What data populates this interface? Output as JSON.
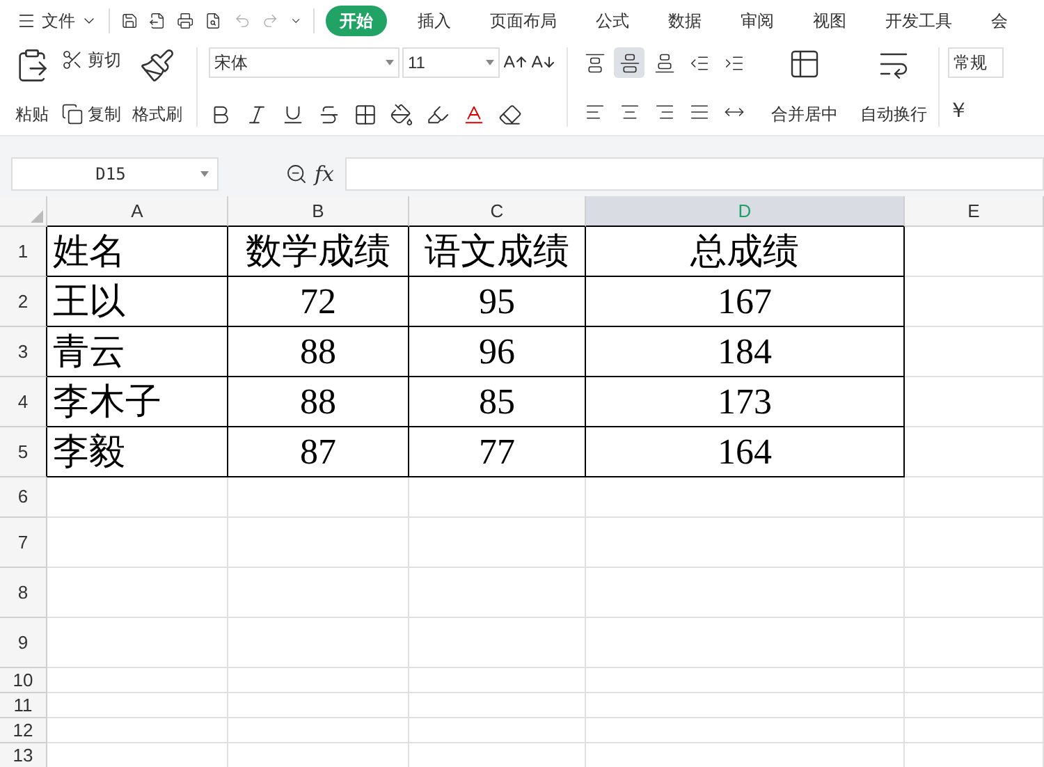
{
  "menu": {
    "label": "文件"
  },
  "tabs": [
    {
      "label": "开始",
      "selected": true
    },
    {
      "label": "插入",
      "selected": false
    },
    {
      "label": "页面布局",
      "selected": false
    },
    {
      "label": "公式",
      "selected": false
    },
    {
      "label": "数据",
      "selected": false
    },
    {
      "label": "审阅",
      "selected": false
    },
    {
      "label": "视图",
      "selected": false
    },
    {
      "label": "开发工具",
      "selected": false
    },
    {
      "label": "会",
      "selected": false
    }
  ],
  "clipboard": {
    "paste": "粘贴",
    "cut": "剪切",
    "copy": "复制",
    "format_painter": "格式刷"
  },
  "font": {
    "name": "宋体",
    "size": "11"
  },
  "align_buttons": [
    {
      "kind": "top",
      "selected": false
    },
    {
      "kind": "middle",
      "selected": true
    },
    {
      "kind": "bottom",
      "selected": false
    },
    {
      "kind": "outdent",
      "selected": false
    },
    {
      "kind": "indent",
      "selected": false
    },
    {
      "kind": "left",
      "selected": false
    },
    {
      "kind": "center",
      "selected": false
    },
    {
      "kind": "right",
      "selected": false
    },
    {
      "kind": "justify",
      "selected": false
    },
    {
      "kind": "distribute",
      "selected": false
    }
  ],
  "merge": "合并居中",
  "wrap": "自动换行",
  "number_format": "常规",
  "currency": "￥",
  "name_box": "D15",
  "formula_label": "fx",
  "sheet": {
    "columns": [
      {
        "label": "A",
        "selected": false
      },
      {
        "label": "B",
        "selected": false
      },
      {
        "label": "C",
        "selected": false
      },
      {
        "label": "D",
        "selected": true
      },
      {
        "label": "E",
        "selected": false
      }
    ],
    "rows": [
      {
        "label": "1",
        "cells": [
          "姓名",
          "数学成绩",
          "语文成绩",
          "总成绩"
        ]
      },
      {
        "label": "2",
        "cells": [
          "王以",
          "72",
          "95",
          "167"
        ]
      },
      {
        "label": "3",
        "cells": [
          "青云",
          "88",
          "96",
          "184"
        ]
      },
      {
        "label": "4",
        "cells": [
          "李木子",
          "88",
          "85",
          "173"
        ]
      },
      {
        "label": "5",
        "cells": [
          "李毅",
          "87",
          "77",
          "164"
        ]
      },
      {
        "label": "6"
      },
      {
        "label": "7"
      },
      {
        "label": "8"
      },
      {
        "label": "9"
      },
      {
        "label": "10"
      },
      {
        "label": "11"
      },
      {
        "label": "12"
      },
      {
        "label": "13"
      }
    ]
  }
}
